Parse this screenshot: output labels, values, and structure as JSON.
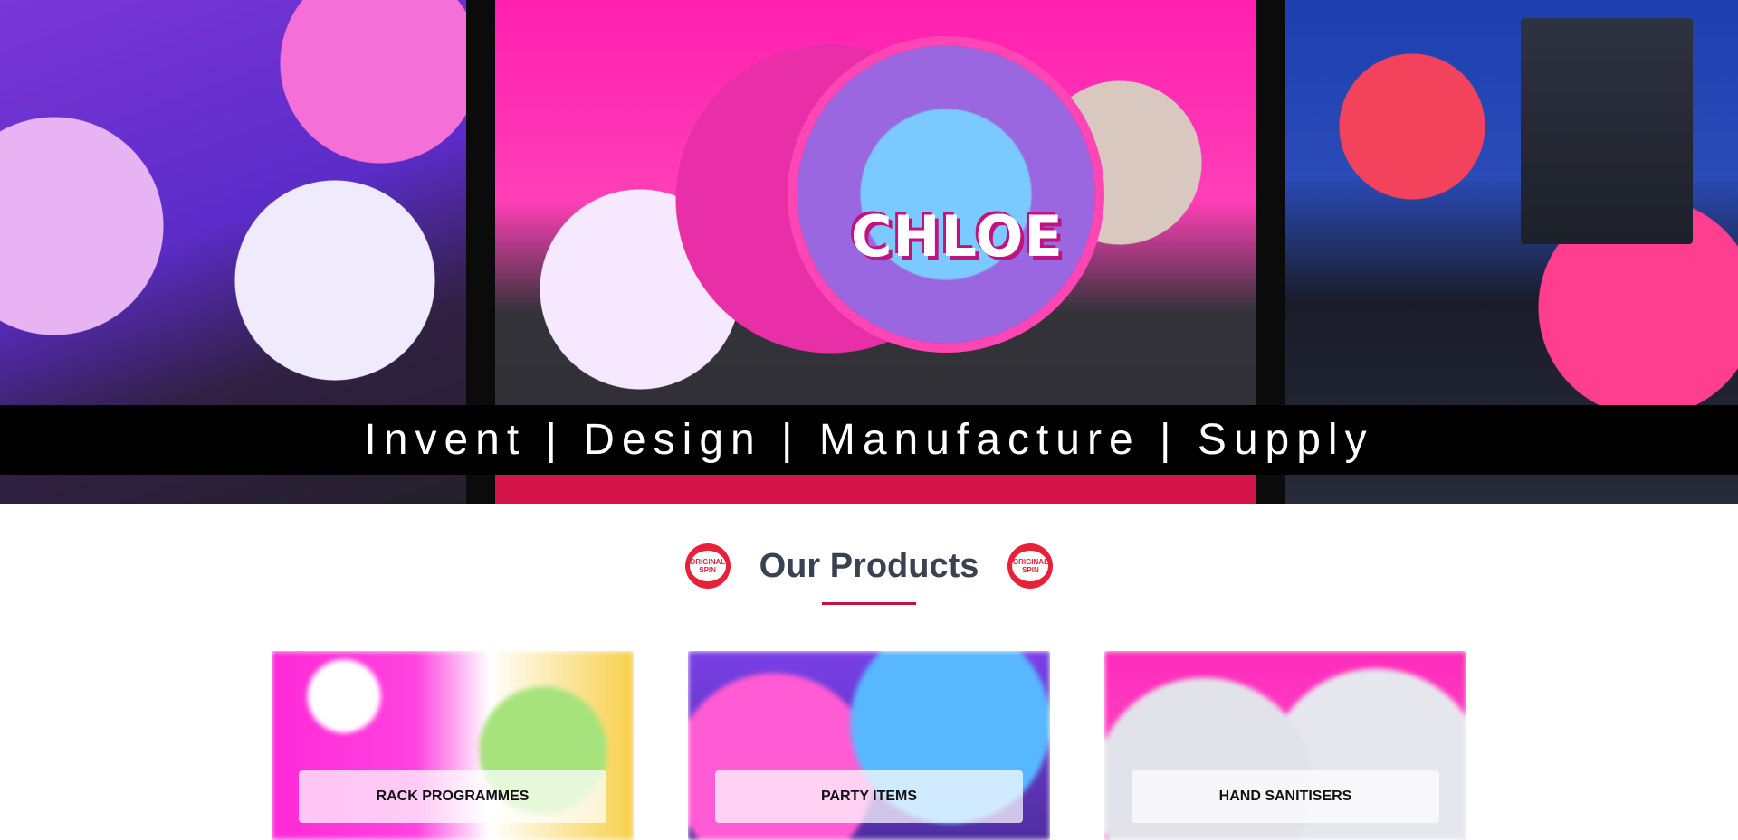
{
  "hero": {
    "tagline": "Invent | Design | Manufacture | Supply",
    "featured_name": "CHLOE",
    "colors": {
      "tagline_bar": "#000000",
      "accent_stripe": "#d41448"
    }
  },
  "products_section": {
    "title": "Our Products",
    "logo_text_line1": "ORIGINAL",
    "logo_text_line2": "SPIN",
    "underline_color": "#c4123f",
    "cards": [
      {
        "label": "RACK PROGRAMMES"
      },
      {
        "label": "PARTY ITEMS"
      },
      {
        "label": "HAND SANITISERS"
      }
    ]
  },
  "colors": {
    "logo_red": "#e8213a",
    "heading_text": "#3a4252"
  }
}
